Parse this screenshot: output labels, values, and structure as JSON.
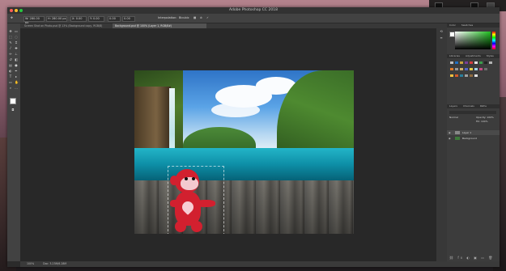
{
  "window": {
    "title": "Adobe Photoshop CC 2018"
  },
  "options_bar": {
    "fields": [
      "W: 280.00 px",
      "H: 280.00 px",
      "X: 0.00",
      "Y: 0.00",
      "0.00",
      "0.00"
    ],
    "interpolation_label": "Interpolation:",
    "interpolation_value": "Bicubic"
  },
  "tabs": [
    {
      "label": "Screen Shot on Photo.psd @ 13% (Background copy, RGB/8)",
      "active": false
    },
    {
      "label": "Background.psd @ 100% (Layer 1, RGB/8#)",
      "active": true
    }
  ],
  "panels": {
    "color_tabs": [
      "Color",
      "Swatches"
    ],
    "library_tabs": [
      "Libraries",
      "Adjustments",
      "Styles"
    ],
    "layers_tabs": [
      "Layers",
      "Channels",
      "Paths"
    ],
    "blend_mode": "Normal",
    "opacity_label": "Opacity: 100%",
    "fill_label": "Fill: 100%",
    "layers": [
      {
        "name": "Layer 1"
      },
      {
        "name": "Background"
      }
    ]
  },
  "status": {
    "zoom": "100%",
    "doc_info": "Doc: 3.23M/6.28M"
  },
  "colors": {
    "accent": "#1f70c5",
    "bg_dark": "#282828",
    "panel": "#3c3c3c"
  }
}
